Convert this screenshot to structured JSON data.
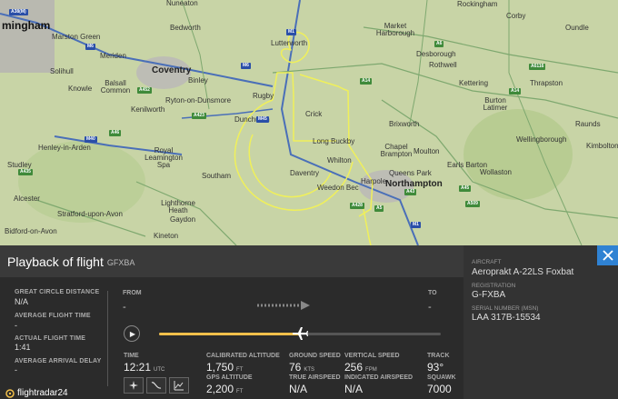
{
  "map": {
    "towns": [
      {
        "name": "Nuneaton",
        "cls": ""
      },
      {
        "name": "Rockingham",
        "cls": ""
      },
      {
        "name": "Corby",
        "cls": ""
      },
      {
        "name": "mingham",
        "cls": "huge"
      },
      {
        "name": "Marston Green",
        "cls": ""
      },
      {
        "name": "Bedworth",
        "cls": ""
      },
      {
        "name": "Lutterworth",
        "cls": ""
      },
      {
        "name": "Market Harborough",
        "cls": ""
      },
      {
        "name": "Oundle",
        "cls": ""
      },
      {
        "name": "Coventry",
        "cls": "big"
      },
      {
        "name": "Solihull",
        "cls": ""
      },
      {
        "name": "Meriden",
        "cls": ""
      },
      {
        "name": "Binley",
        "cls": ""
      },
      {
        "name": "Desborough",
        "cls": ""
      },
      {
        "name": "Rothwell",
        "cls": ""
      },
      {
        "name": "Knowle",
        "cls": ""
      },
      {
        "name": "Balsall Common",
        "cls": ""
      },
      {
        "name": "Ryton-on-Dunsmore",
        "cls": ""
      },
      {
        "name": "Rugby",
        "cls": ""
      },
      {
        "name": "Kettering",
        "cls": ""
      },
      {
        "name": "Thrapston",
        "cls": ""
      },
      {
        "name": "Kenilworth",
        "cls": ""
      },
      {
        "name": "Burton Latimer",
        "cls": ""
      },
      {
        "name": "Dunchurch",
        "cls": ""
      },
      {
        "name": "Crick",
        "cls": ""
      },
      {
        "name": "Brixworth",
        "cls": ""
      },
      {
        "name": "Raunds",
        "cls": ""
      },
      {
        "name": "Henley-in-Arden",
        "cls": ""
      },
      {
        "name": "Royal Leamington Spa",
        "cls": ""
      },
      {
        "name": "Long Buckby",
        "cls": ""
      },
      {
        "name": "Chapel Brampton",
        "cls": ""
      },
      {
        "name": "Moulton",
        "cls": ""
      },
      {
        "name": "Wellingborough",
        "cls": ""
      },
      {
        "name": "Kimbolton",
        "cls": ""
      },
      {
        "name": "Studley",
        "cls": ""
      },
      {
        "name": "Southam",
        "cls": ""
      },
      {
        "name": "Daventry",
        "cls": ""
      },
      {
        "name": "Whilton",
        "cls": ""
      },
      {
        "name": "Queens Park",
        "cls": ""
      },
      {
        "name": "Earls Barton",
        "cls": ""
      },
      {
        "name": "Wollaston",
        "cls": ""
      },
      {
        "name": "Harpole",
        "cls": ""
      },
      {
        "name": "Northampton",
        "cls": "big"
      },
      {
        "name": "Weedon Bec",
        "cls": ""
      },
      {
        "name": "Alcester",
        "cls": ""
      },
      {
        "name": "Lighthorne Heath",
        "cls": ""
      },
      {
        "name": "Stratford-upon-Avon",
        "cls": ""
      },
      {
        "name": "Gaydon",
        "cls": ""
      },
      {
        "name": "Bidford-on-Avon",
        "cls": ""
      },
      {
        "name": "Kineton",
        "cls": ""
      }
    ],
    "roads": [
      {
        "label": "A38(M)",
        "kind": "m"
      },
      {
        "label": "M1",
        "kind": "m"
      },
      {
        "label": "M6",
        "kind": "m"
      },
      {
        "label": "M6",
        "kind": "m"
      },
      {
        "label": "M40",
        "kind": "m"
      },
      {
        "label": "M45",
        "kind": "m"
      },
      {
        "label": "M1",
        "kind": "m"
      },
      {
        "label": "A14",
        "kind": "a"
      },
      {
        "label": "A14",
        "kind": "a"
      },
      {
        "label": "A45",
        "kind": "a"
      },
      {
        "label": "A43",
        "kind": "a"
      },
      {
        "label": "A5",
        "kind": "a"
      },
      {
        "label": "A6",
        "kind": "a"
      },
      {
        "label": "A428",
        "kind": "a"
      },
      {
        "label": "A452",
        "kind": "a"
      },
      {
        "label": "A46",
        "kind": "a"
      },
      {
        "label": "A435",
        "kind": "a"
      },
      {
        "label": "A423",
        "kind": "a"
      },
      {
        "label": "A509",
        "kind": "a"
      },
      {
        "label": "A6116",
        "kind": "a"
      }
    ]
  },
  "panel": {
    "title": "Playback of flight",
    "callsign": "GFXBA",
    "great_circle_label": "GREAT CIRCLE DISTANCE",
    "great_circle_value": "N/A",
    "avg_flight_time_label": "AVERAGE FLIGHT TIME",
    "avg_flight_time_value": "-",
    "actual_flight_time_label": "ACTUAL FLIGHT TIME",
    "actual_flight_time_value": "1:41",
    "avg_arrival_delay_label": "AVERAGE ARRIVAL DELAY",
    "avg_arrival_delay_value": "-",
    "from_label": "FROM",
    "from_value": "-",
    "to_label": "TO",
    "to_value": "-",
    "progress": 0.5,
    "time_label": "TIME",
    "time_value": "12:21",
    "time_unit": "UTC",
    "cal_alt_label": "CALIBRATED ALTITUDE",
    "cal_alt_value": "1,750",
    "cal_alt_unit": "FT",
    "gps_alt_label": "GPS ALTITUDE",
    "gps_alt_value": "2,200",
    "gps_alt_unit": "FT",
    "ground_speed_label": "GROUND SPEED",
    "ground_speed_value": "76",
    "ground_speed_unit": "KTS",
    "true_airspeed_label": "TRUE AIRSPEED",
    "true_airspeed_value": "N/A",
    "vertical_speed_label": "VERTICAL SPEED",
    "vertical_speed_value": "256",
    "vertical_speed_unit": "FPM",
    "indicated_airspeed_label": "INDICATED AIRSPEED",
    "indicated_airspeed_value": "N/A",
    "track_label": "TRACK",
    "track_value": "93°",
    "squawk_label": "SQUAWK",
    "squawk_value": "7000",
    "logo_text": "flightradar24"
  },
  "aircraft": {
    "aircraft_label": "AIRCRAFT",
    "aircraft_value": "Aeroprakt A-22LS Foxbat",
    "registration_label": "REGISTRATION",
    "registration_value": "G-FXBA",
    "serial_label": "SERIAL NUMBER (MSN)",
    "serial_value": "LAA 317B-15534"
  },
  "colors": {
    "track": "#f0f05a",
    "accent": "#f3c04b",
    "close": "#2f82d3"
  }
}
